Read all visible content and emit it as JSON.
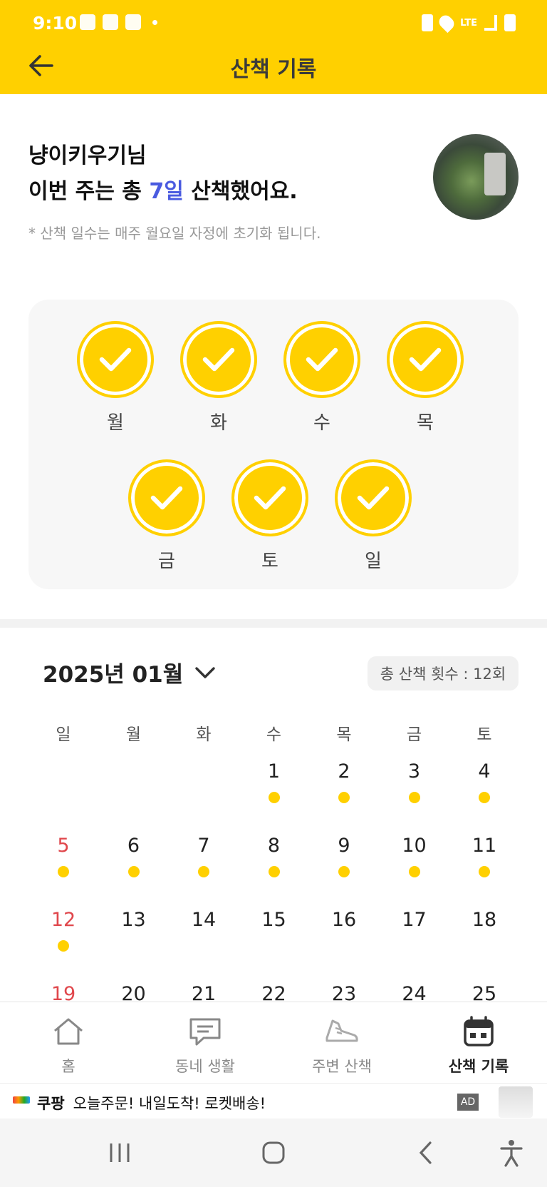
{
  "status_bar": {
    "time": "9:10",
    "network": "LTE"
  },
  "header": {
    "title": "산책 기록",
    "back_icon": "arrow-left-icon"
  },
  "summary": {
    "greeting_name": "냥이키우기님",
    "line_prefix": "이번 주는 총 ",
    "days_count": "7일",
    "line_suffix": " 산책했어요.",
    "note": "* 산책 일수는 매주 월요일 자정에 초기화 됩니다.",
    "highlight_color": "#4A5BE0"
  },
  "week": {
    "days": [
      {
        "label": "월",
        "walked": true
      },
      {
        "label": "화",
        "walked": true
      },
      {
        "label": "수",
        "walked": true
      },
      {
        "label": "목",
        "walked": true
      },
      {
        "label": "금",
        "walked": true
      },
      {
        "label": "토",
        "walked": true
      },
      {
        "label": "일",
        "walked": true
      }
    ],
    "accent": "#FFD000"
  },
  "calendar": {
    "month_label": "2025년 01월",
    "total_walks": "총 산책 횟수 : 12회",
    "weekdays": [
      "일",
      "월",
      "화",
      "수",
      "목",
      "금",
      "토"
    ],
    "rows": [
      [
        null,
        null,
        null,
        "1",
        "2",
        "3",
        "4"
      ],
      [
        "5",
        "6",
        "7",
        "8",
        "9",
        "10",
        "11"
      ],
      [
        "12",
        "13",
        "14",
        "15",
        "16",
        "17",
        "18"
      ],
      [
        "19",
        "20",
        "21",
        "22",
        "23",
        "24",
        "25"
      ]
    ],
    "walked_dates": [
      "1",
      "2",
      "3",
      "4",
      "5",
      "6",
      "7",
      "8",
      "9",
      "10",
      "11",
      "12"
    ],
    "today": "12"
  },
  "bottom_nav": [
    {
      "label": "홈",
      "icon": "home-icon",
      "active": false
    },
    {
      "label": "동네 생활",
      "icon": "chat-icon",
      "active": false
    },
    {
      "label": "주변 산책",
      "icon": "shoe-icon",
      "active": false
    },
    {
      "label": "산책 기록",
      "icon": "calendar-icon",
      "active": true
    }
  ],
  "ad": {
    "brand": "쿠팡",
    "text": "오늘주문! 내일도착! 로켓배송!",
    "badge": "AD"
  },
  "system_nav": {
    "recents_icon": "recents-icon",
    "home_icon": "home-circle-icon",
    "back_icon": "back-chevron-icon",
    "a11y_icon": "accessibility-icon"
  }
}
